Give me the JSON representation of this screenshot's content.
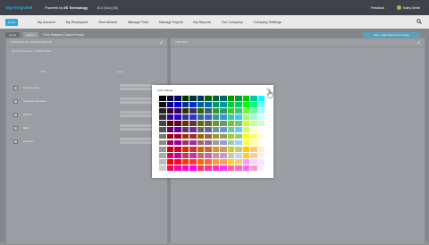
{
  "topbar": {
    "logo": "Sig·Integrated",
    "powered_prefix": "Powered by",
    "powered_brand": "IIS Technology",
    "version": "10.0 (Gov) (IIS)",
    "feedback": "Feedback",
    "user": "Kathy Smith"
  },
  "nav": {
    "home": "Home",
    "items": [
      "My Account",
      "My Employees",
      "Recruitment",
      "Manage Time",
      "Manage Payroll",
      "My Reports",
      "Our Company",
      "Company Settings"
    ]
  },
  "crumbs": {
    "a": "Home",
    "b": "Forms",
    "title": "Form Designer (Custom Forms)",
    "top_button": "Save · Edit Custom Form Setup"
  },
  "filters": [
    "Some filter",
    "Show Options"
  ],
  "left_panel": {
    "title": "FORM FIELDS CONFIGURATION",
    "sub": "Name: Recruitment · Candidate Profile",
    "col_a": "Label",
    "col_b": "Actions",
    "rows": [
      "Section Header",
      "Candidate Field Name",
      "Website",
      "Skills",
      "Education"
    ]
  },
  "right_panel": {
    "title": "PREVIEW"
  },
  "dialog": {
    "title": "Color Palette",
    "colors": [
      "#000000",
      "#000033",
      "#000066",
      "#003300",
      "#003333",
      "#003366",
      "#006600",
      "#006633",
      "#006666",
      "#009900",
      "#009933",
      "#00cc00",
      "#00cc99",
      "#00ffff",
      "#111111",
      "#000099",
      "#0000cc",
      "#003399",
      "#0033cc",
      "#006699",
      "#0066cc",
      "#009966",
      "#009999",
      "#00cc33",
      "#00cc66",
      "#00ff00",
      "#00ff66",
      "#66ffff",
      "#222222",
      "#330033",
      "#330066",
      "#333300",
      "#333366",
      "#336600",
      "#336666",
      "#339933",
      "#339966",
      "#33cc33",
      "#33cc66",
      "#66ff33",
      "#66ff99",
      "#99ffff",
      "#333333",
      "#330099",
      "#3300cc",
      "#333399",
      "#3333cc",
      "#336699",
      "#3366cc",
      "#339999",
      "#3399cc",
      "#33cc99",
      "#33ccff",
      "#99ff66",
      "#99ffcc",
      "#ccffff",
      "#444444",
      "#660000",
      "#660033",
      "#663300",
      "#663333",
      "#666600",
      "#666633",
      "#669933",
      "#669966",
      "#66cc33",
      "#66cc66",
      "#ccff33",
      "#ccff99",
      "#ccffcc",
      "#555555",
      "#660066",
      "#660099",
      "#663366",
      "#663399",
      "#666666",
      "#666699",
      "#669999",
      "#6699cc",
      "#66cc99",
      "#66ccff",
      "#ccff66",
      "#ffffcc",
      "#ffffff",
      "#777777",
      "#990000",
      "#990033",
      "#993300",
      "#993333",
      "#996600",
      "#996633",
      "#999933",
      "#999966",
      "#99cc33",
      "#99cc66",
      "#ffff00",
      "#ffff66",
      "#ffffcc",
      "#888888",
      "#990066",
      "#990099",
      "#993366",
      "#993399",
      "#996666",
      "#996699",
      "#999999",
      "#9999cc",
      "#99cc99",
      "#99ccff",
      "#ffff33",
      "#ffff99",
      "#ffffee",
      "#999999",
      "#cc0000",
      "#cc0033",
      "#cc3300",
      "#cc3333",
      "#cc6600",
      "#cc6633",
      "#cc9933",
      "#cc9966",
      "#cccc33",
      "#cccc66",
      "#ffcc00",
      "#ffcc66",
      "#ffeecc",
      "#aaaaaa",
      "#cc0066",
      "#cc0099",
      "#cc3366",
      "#cc3399",
      "#cc6666",
      "#cc6699",
      "#cc9999",
      "#cc99cc",
      "#cccc99",
      "#ccccff",
      "#ffcc33",
      "#ffcc99",
      "#fff0dd",
      "#bbbbbb",
      "#ff0000",
      "#ff0033",
      "#ff3300",
      "#ff3333",
      "#ff6600",
      "#ff6633",
      "#ff9933",
      "#ff9966",
      "#ffcc33",
      "#ffcc66",
      "#ff99ff",
      "#ffccff",
      "#ffe0ff",
      "#cccccc",
      "#ff0066",
      "#ff0099",
      "#ff00cc",
      "#ff00ff",
      "#ff3366",
      "#ff3399",
      "#ff33cc",
      "#ff33ff",
      "#ff6699",
      "#ff66cc",
      "#ff66ff",
      "#ff99cc",
      "#ffeeff"
    ]
  },
  "colors": {
    "topbar": "#3f4249",
    "accent": "#2aa8e0",
    "status_dot": "#8ec641"
  }
}
